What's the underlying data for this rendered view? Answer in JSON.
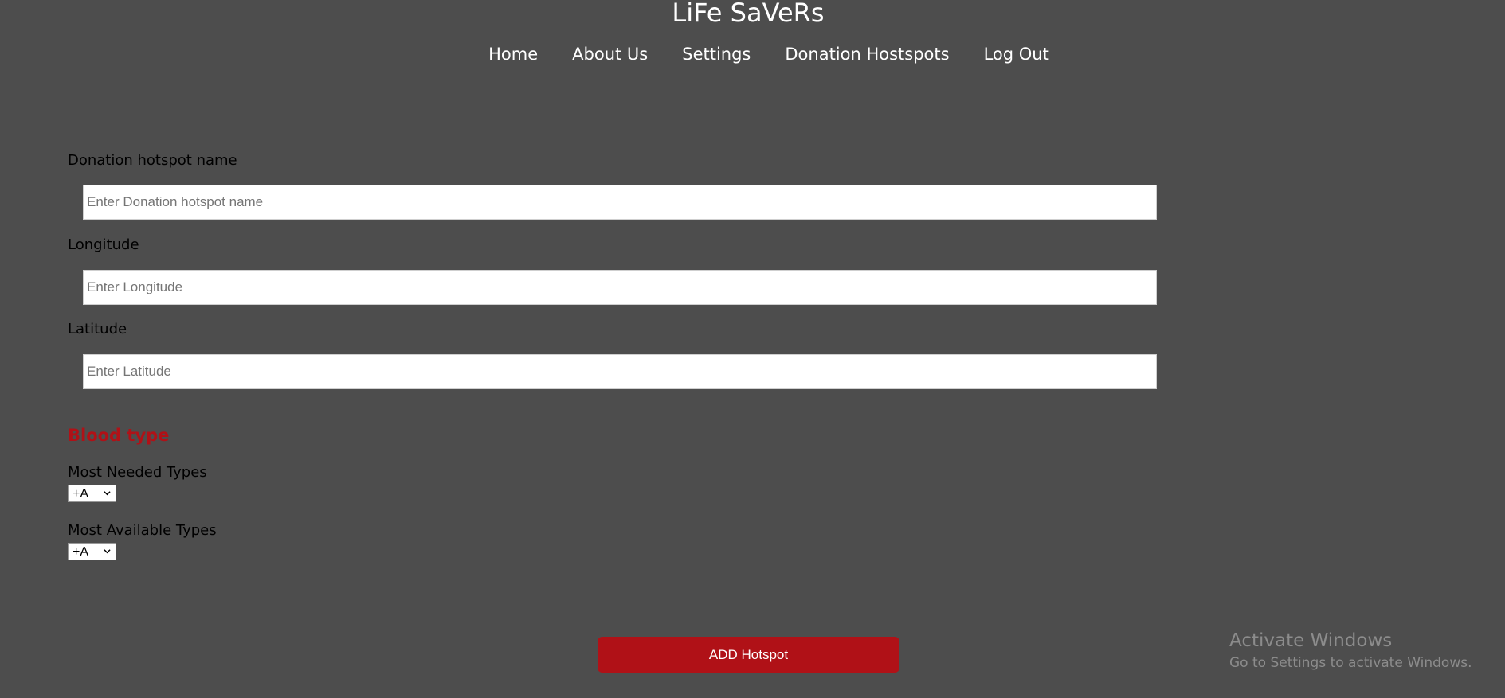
{
  "header": {
    "site_title": "LiFe SaVeRs"
  },
  "nav": {
    "items": [
      {
        "label": "Home"
      },
      {
        "label": "About Us"
      },
      {
        "label": "Settings"
      },
      {
        "label": "Donation Hostspots"
      },
      {
        "label": "Log Out"
      }
    ]
  },
  "form": {
    "hotspot_name": {
      "label": "Donation hotspot name",
      "placeholder": "Enter Donation hotspot name",
      "value": ""
    },
    "longitude": {
      "label": "Longitude",
      "placeholder": "Enter Longitude",
      "value": ""
    },
    "latitude": {
      "label": "Latitude",
      "placeholder": "Enter Latitude",
      "value": ""
    },
    "blood_type_heading": "Blood type",
    "most_needed": {
      "label": "Most Needed Types",
      "selected": "+A"
    },
    "most_available": {
      "label": "Most Available Types",
      "selected": "+A"
    },
    "submit_label": "ADD Hotspot"
  },
  "watermark": {
    "title": "Activate Windows",
    "subtitle": "Go to Settings to activate Windows."
  },
  "colors": {
    "background": "#4d4d4d",
    "accent_red": "#b01117",
    "text_white": "#ffffff",
    "watermark_gray": "#8c8c8c"
  }
}
